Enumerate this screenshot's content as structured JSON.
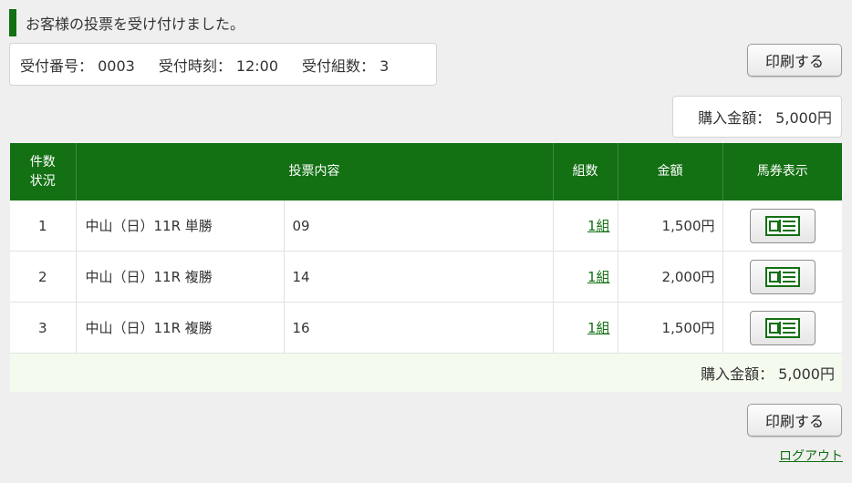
{
  "notice": {
    "text": "お客様の投票を受け付けました。"
  },
  "receipt": {
    "number": "受付番号： 0003",
    "time": "受付時刻： 12:00",
    "groups": "受付組数： 3"
  },
  "buttons": {
    "print": "印刷する"
  },
  "total": {
    "label": "購入金額： 5,000円"
  },
  "table": {
    "headers": {
      "count_status_line1": "件数",
      "count_status_line2": "状況",
      "content": "投票内容",
      "group_count": "組数",
      "amount": "金額",
      "ticket": "馬券表示"
    },
    "rows": [
      {
        "no": "1",
        "race": "中山（日）11R 単勝",
        "combo": "09",
        "count": "1組",
        "amount": "1,500円"
      },
      {
        "no": "2",
        "race": "中山（日）11R 複勝",
        "combo": "14",
        "count": "1組",
        "amount": "2,000円"
      },
      {
        "no": "3",
        "race": "中山（日）11R 複勝",
        "combo": "16",
        "count": "1組",
        "amount": "1,500円"
      }
    ],
    "total_label": "購入金額： 5,000円"
  },
  "logout": "ログアウト",
  "colors": {
    "accent": "#137013",
    "total_row_bg": "#f4fbee",
    "page_bg": "#efefef"
  },
  "icons": {
    "ticket": "ticket-view-icon"
  }
}
